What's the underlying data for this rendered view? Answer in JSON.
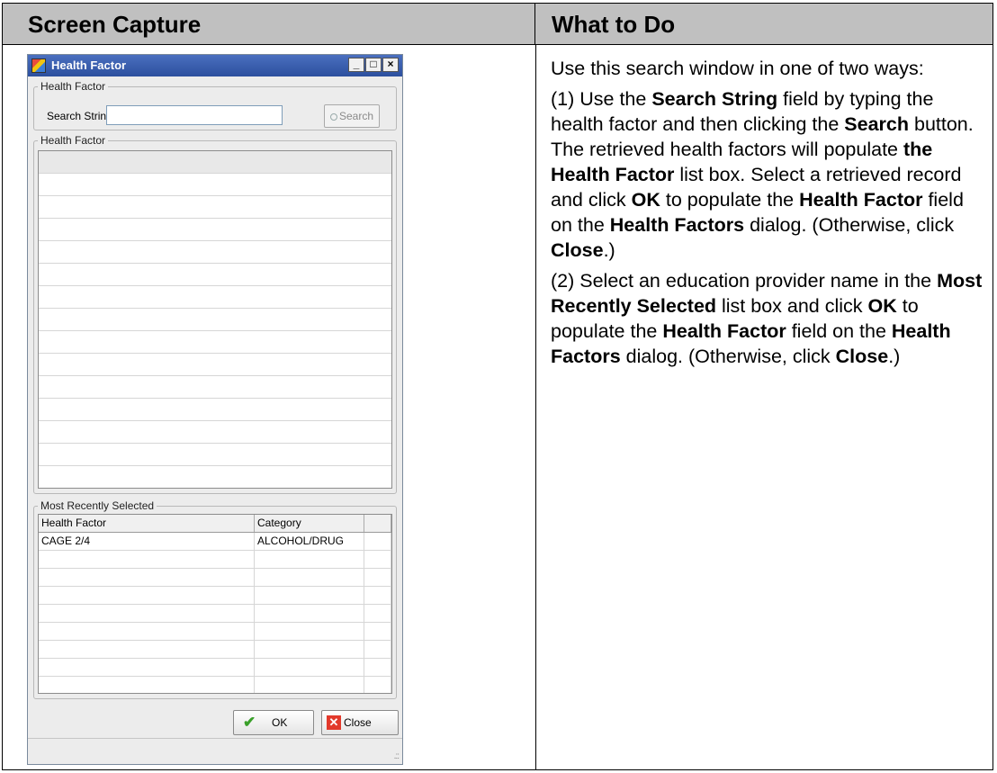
{
  "table": {
    "left_header": "Screen Capture",
    "right_header": "What to Do"
  },
  "dialog": {
    "title": "Health Factor",
    "window_buttons": {
      "minimize": "_",
      "maximize": "□",
      "close": "×"
    },
    "search_group": {
      "legend": "Health Factor",
      "search_label": "Search String",
      "search_value": "",
      "search_button": "Search"
    },
    "results_group": {
      "legend": "Health Factor",
      "row_count": 16
    },
    "recent_group": {
      "legend": "Most Recently Selected",
      "columns": [
        "Health Factor",
        "Category",
        ""
      ],
      "rows": [
        {
          "health_factor": "CAGE 2/4",
          "category": "ALCOHOL/DRUG"
        }
      ],
      "blank_rows": 8
    },
    "ok_button": "OK",
    "close_button": "Close",
    "resize_grip": ".::"
  },
  "instructions": {
    "intro": "Use this search window in one of two ways:",
    "step1": {
      "a": "(1) Use the ",
      "b": "Search String",
      "c": " field by typing the health factor and then clicking the ",
      "d": "Search",
      "e": " button. The retrieved health factors will populate ",
      "f": "the Health Factor",
      "g": " list box. Select a retrieved record and click ",
      "h": "OK",
      "i": " to populate the ",
      "j": "Health Factor",
      "k": " field on the ",
      "l": "Health Factors",
      "m": " dialog. (Otherwise, click ",
      "n": "Close",
      "o": ".)"
    },
    "step2": {
      "a": "(2) Select an education provider name in the ",
      "b": "Most Recently Selected",
      "c": " list box and click ",
      "d": "OK",
      "e": " to populate the ",
      "f": "Health Factor",
      "g": " field on the ",
      "h": "Health Factors",
      "i": " dialog. (Otherwise, click ",
      "j": "Close",
      "k": ".)"
    }
  }
}
